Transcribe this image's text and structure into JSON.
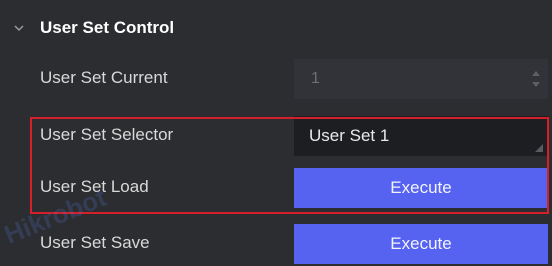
{
  "group": {
    "title": "User Set Control",
    "expanded_icon": "chevron-down-icon"
  },
  "rows": [
    {
      "label": "User Set Current",
      "type": "spinbox",
      "value": "1",
      "disabled": true
    },
    {
      "label": "User Set Selector",
      "type": "select",
      "value": "User Set 1"
    },
    {
      "label": "User Set Load",
      "type": "button",
      "button_label": "Execute"
    },
    {
      "label": "User Set Save",
      "type": "button",
      "button_label": "Execute"
    }
  ],
  "watermark": "Hikrobot",
  "colors": {
    "background": "#2c2d30",
    "button": "#5563f0",
    "select_bg": "#1d1e21",
    "highlight": "#d4202a"
  }
}
